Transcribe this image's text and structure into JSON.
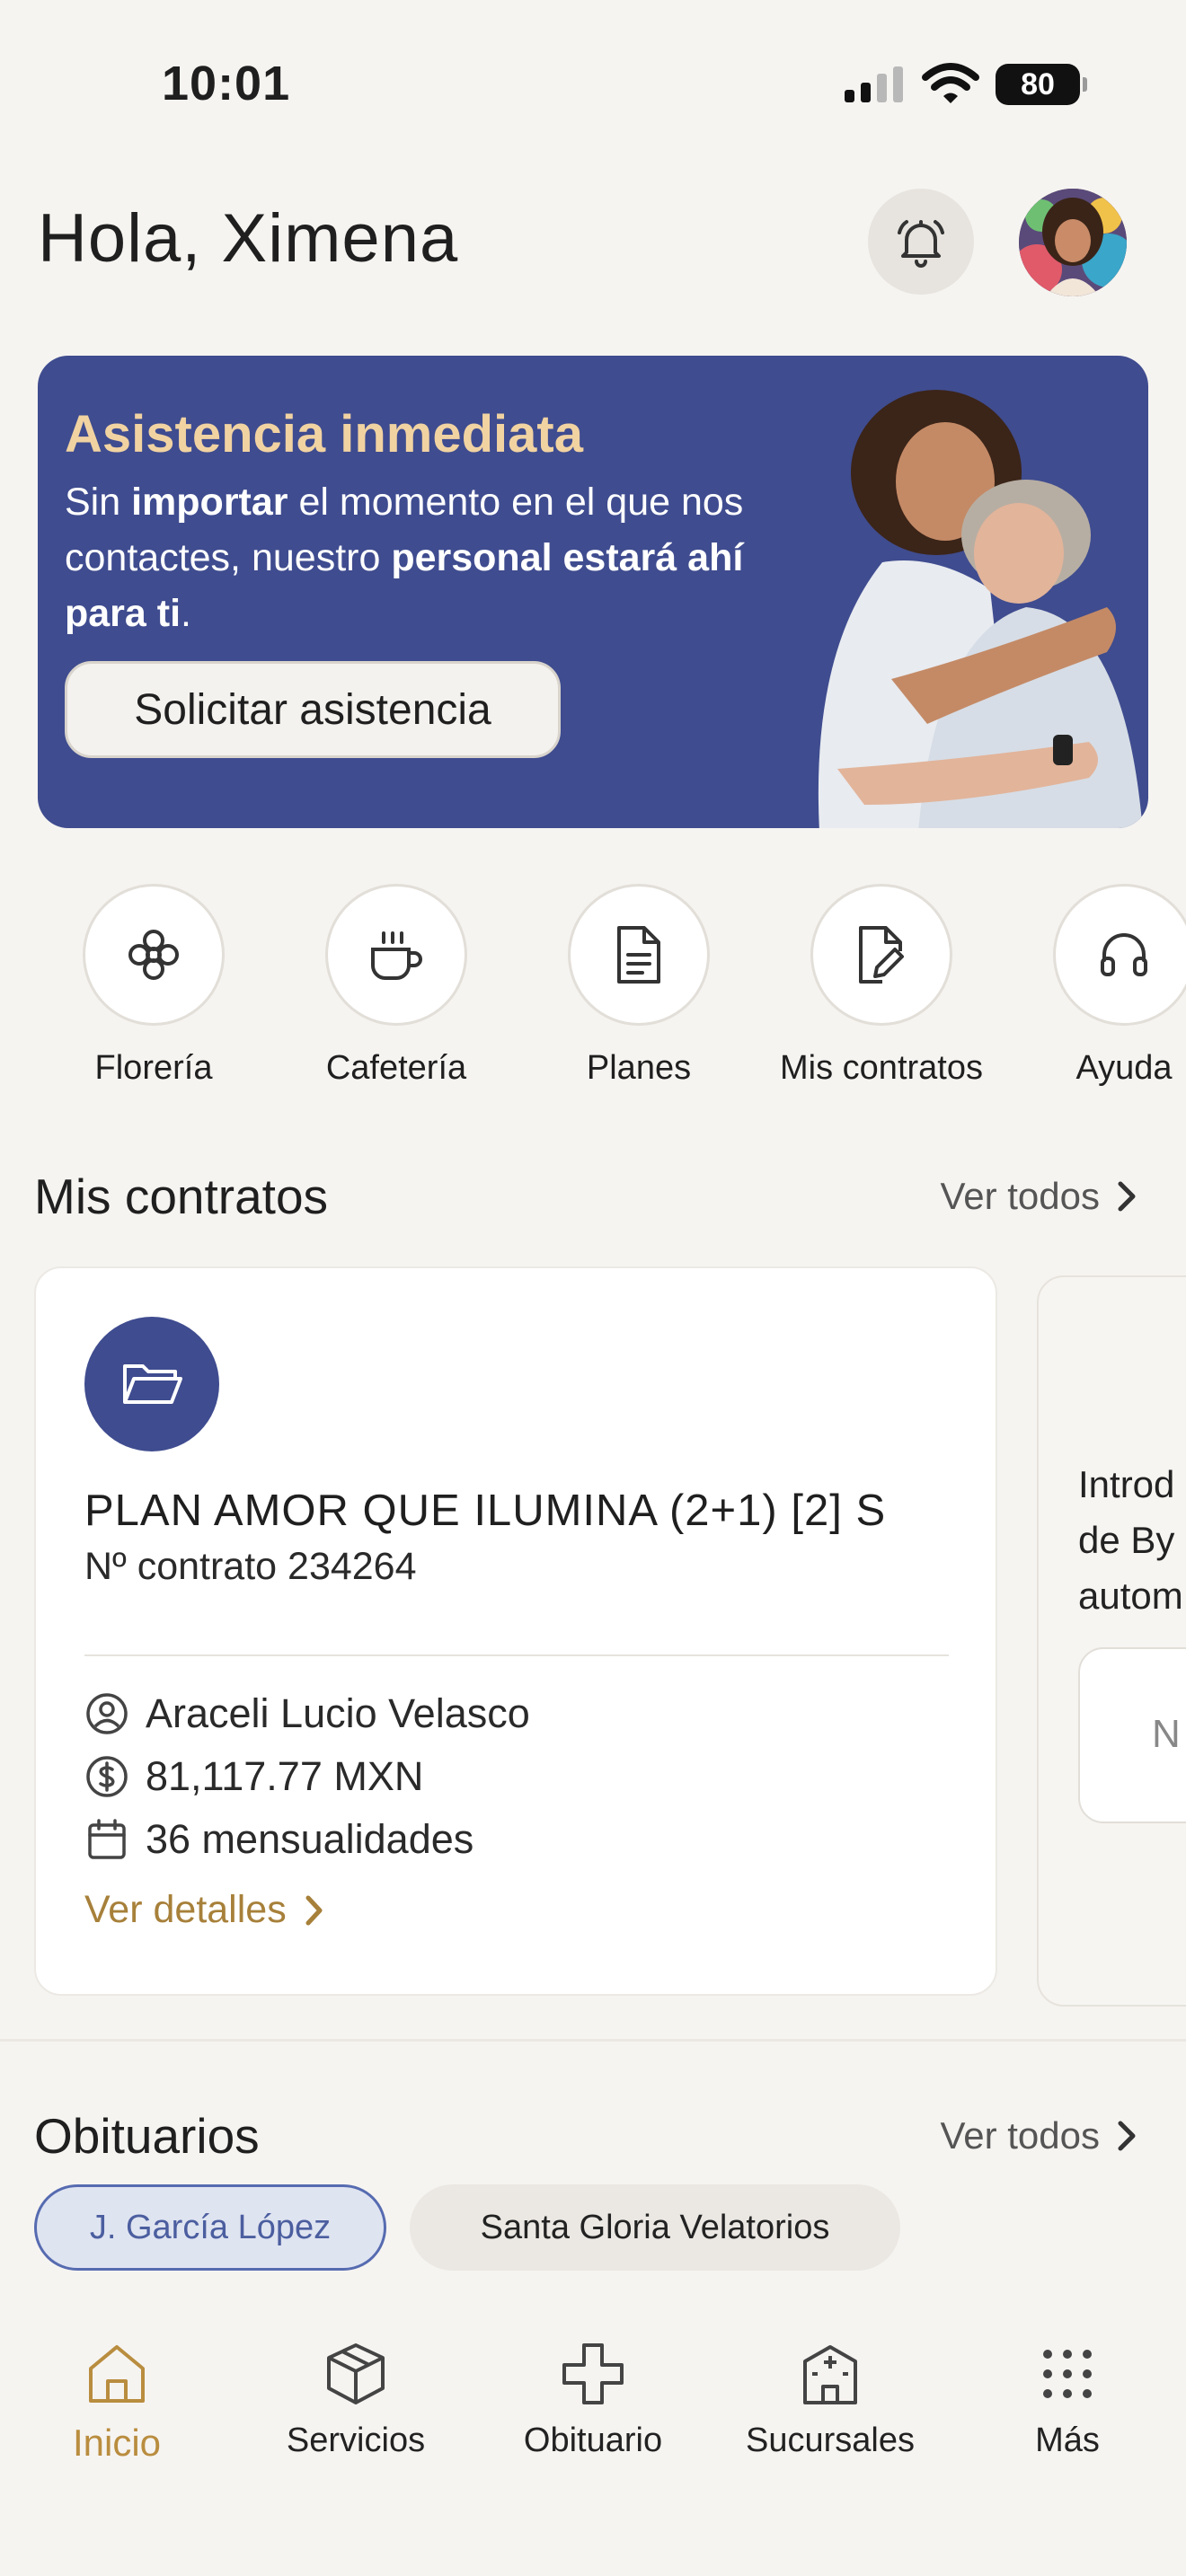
{
  "status_bar": {
    "time": "10:01",
    "battery": "80"
  },
  "header": {
    "greeting": "Hola, Ximena"
  },
  "banner": {
    "title": "Asistencia inmediata",
    "text_1": "Sin ",
    "text_2": "importar",
    "text_3": " el momento en el que nos contactes, nuestro ",
    "text_4": "personal estará ahí para ti",
    "text_5": ".",
    "button": "Solicitar asistencia"
  },
  "quick_actions": [
    {
      "label": "Florería",
      "icon": "flower-icon"
    },
    {
      "label": "Cafetería",
      "icon": "coffee-cup-icon"
    },
    {
      "label": "Planes",
      "icon": "document-icon"
    },
    {
      "label": "Mis contratos",
      "icon": "document-pen-icon"
    },
    {
      "label": "Ayuda",
      "icon": "headset-icon"
    }
  ],
  "contracts": {
    "title": "Mis contratos",
    "see_all": "Ver todos",
    "card": {
      "plan_name": "PLAN AMOR QUE ILUMINA (2+1) [2] S",
      "contract_number": "Nº contrato 234264",
      "holder": "Araceli Lucio Velasco",
      "amount": "81,117.77 MXN",
      "installments": "36 mensualidades",
      "details_link": "Ver detalles"
    },
    "peek_card": {
      "line_1": "Introd",
      "line_2": "de By",
      "line_3": "autom",
      "box_text": "N"
    }
  },
  "obituaries": {
    "title": "Obituarios",
    "see_all": "Ver todos",
    "chips": [
      "J. García López",
      "Santa Gloria Velatorios"
    ]
  },
  "bottom_nav": [
    {
      "label": "Inicio",
      "icon": "home-icon",
      "active": true
    },
    {
      "label": "Servicios",
      "icon": "box-icon",
      "active": false
    },
    {
      "label": "Obituario",
      "icon": "cross-icon",
      "active": false
    },
    {
      "label": "Sucursales",
      "icon": "building-icon",
      "active": false
    },
    {
      "label": "Más",
      "icon": "grid-dots-icon",
      "active": false
    }
  ],
  "colors": {
    "background": "#f6f4f1",
    "banner": "#3f4c8f",
    "banner_title": "#f1d3a2",
    "accent_gold": "#b98d3f",
    "chip_active_border": "#566bb0"
  }
}
